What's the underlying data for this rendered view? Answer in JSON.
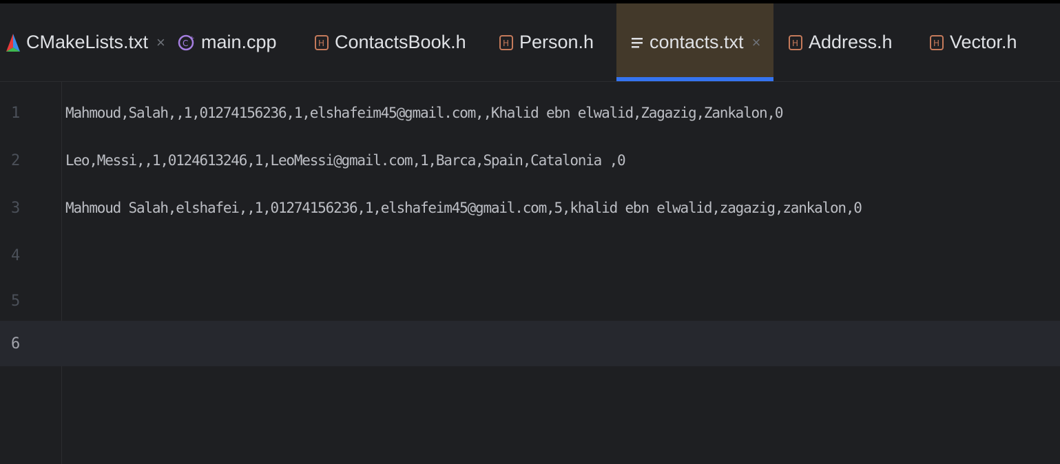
{
  "tabs": [
    {
      "label": "CMakeLists.txt",
      "icon": "cmake-icon",
      "closable": true,
      "active": false
    },
    {
      "label": "main.cpp",
      "icon": "cpp-file-icon",
      "closable": false,
      "active": false
    },
    {
      "label": "ContactsBook.h",
      "icon": "header-file-icon",
      "closable": false,
      "active": false
    },
    {
      "label": "Person.h",
      "icon": "header-file-icon",
      "closable": false,
      "active": false
    },
    {
      "label": "contacts.txt",
      "icon": "text-file-icon",
      "closable": true,
      "active": true
    },
    {
      "label": "Address.h",
      "icon": "header-file-icon",
      "closable": false,
      "active": false
    },
    {
      "label": "Vector.h",
      "icon": "header-file-icon",
      "closable": false,
      "active": false
    }
  ],
  "close_glyph": "×",
  "editor": {
    "lines": [
      {
        "number": "1",
        "text": "Mahmoud,Salah,,1,01274156236,1,elshafeim45@gmail.com,,Khalid ebn elwalid,Zagazig,Zankalon,0"
      },
      {
        "number": "2",
        "text": "Leo,Messi,,1,0124613246,1,LeoMessi@gmail.com,1,Barca,Spain,Catalonia ,0"
      },
      {
        "number": "3",
        "text": "Mahmoud Salah,elshafei,,1,01274156236,1,elshafeim45@gmail.com,5,khalid ebn elwalid,zagazig,zankalon,0"
      },
      {
        "number": "4",
        "text": ""
      },
      {
        "number": "5",
        "text": ""
      },
      {
        "number": "6",
        "text": ""
      }
    ],
    "current_line": "6"
  },
  "colors": {
    "background": "#1e1f22",
    "active_tab_bg": "#43392a",
    "active_tab_underline": "#3574f0",
    "header_icon": "#c57a5b",
    "cpp_icon": "#a57ee0"
  }
}
